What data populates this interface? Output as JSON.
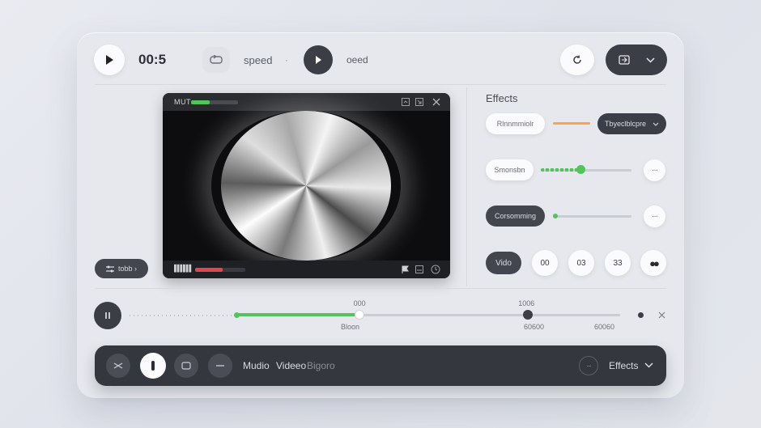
{
  "topbar": {
    "time": "00:5",
    "speed_label": "speed",
    "speed_separator": "·",
    "speed_label_2": "oeed"
  },
  "left": {
    "filter_label": "tobb ›"
  },
  "video": {
    "title": "MUT",
    "progress_top": 0.4,
    "progress_bottom": 0.55,
    "bottom_ticks": "▌▌▌▌▌▌"
  },
  "effects": {
    "heading": "Effects",
    "row1": {
      "label": "Rlnnmmiolr",
      "dropdown": "Tbyeclblcpre"
    },
    "row2": {
      "label": "Smonsbn",
      "level": 0.44
    },
    "row3": {
      "label": "Corsomming",
      "level": 0.02
    },
    "row4": {
      "label": "Vido",
      "chips": [
        "00",
        "03",
        "33"
      ]
    }
  },
  "timeline": {
    "marker_a_label": "000",
    "marker_b_label": "1006",
    "below_a": "Bloon",
    "below_b": "60600",
    "below_c": "60060",
    "played": 0.32,
    "marker_b": 0.76
  },
  "bottombar": {
    "audio_label": "Mudio",
    "video_label": "Videeo",
    "extra_label": "Bigoro",
    "effects_label": "Effects"
  },
  "colors": {
    "accent_green": "#52c45c",
    "accent_red": "#e0474c",
    "accent_orange": "#f0a75a",
    "dark": "#3b3e46"
  }
}
